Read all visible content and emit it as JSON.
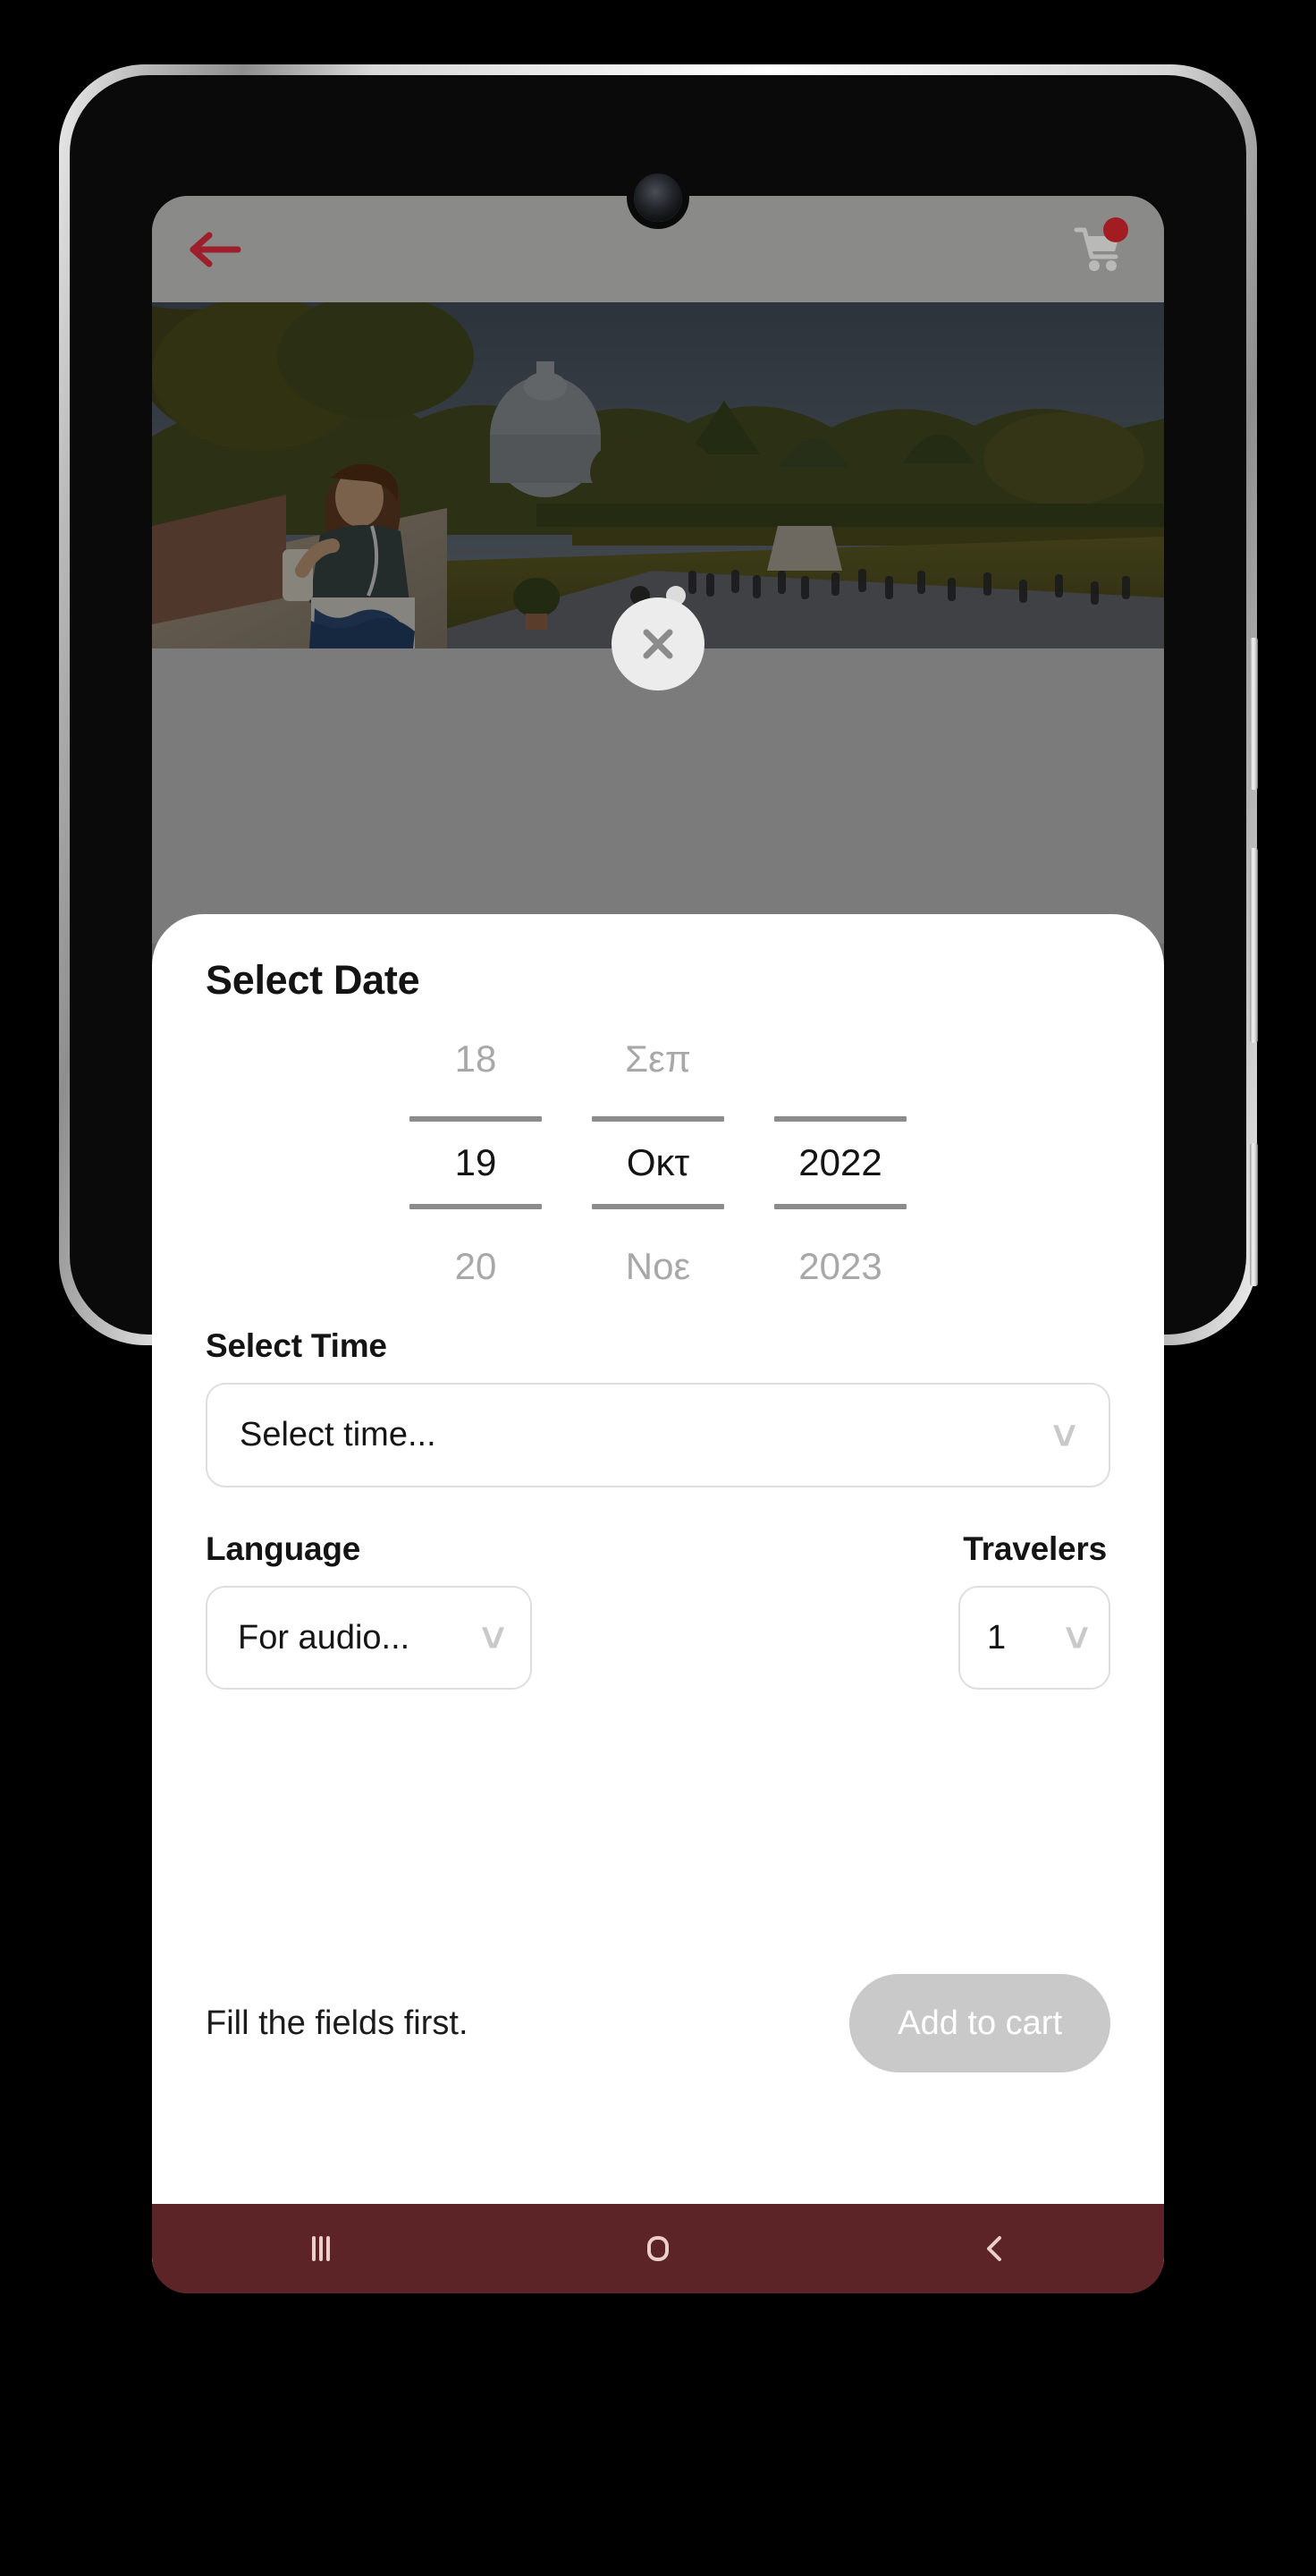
{
  "app": {
    "topbar": {
      "back_icon": "back-arrow-icon",
      "cart_icon": "shopping-cart-icon",
      "cart_badge_color": "#a21c22",
      "bar_color": "#8a8a88"
    },
    "gallery": {
      "alt": "Woman with smartphone walking in the Vatican Gardens with St. Peter's Basilica dome in the background",
      "dots_total": 2,
      "dots_active_index": 0
    },
    "close_button": {
      "icon": "close-x-icon",
      "label": "Close"
    }
  },
  "sheet": {
    "select_date": {
      "title": "Select Date",
      "day": {
        "above": "18",
        "current": "19",
        "below": "20"
      },
      "month": {
        "above": "Σεπ",
        "current": "Οκτ",
        "below": "Νοε"
      },
      "year": {
        "above": "",
        "current": "2022",
        "below": "2023"
      }
    },
    "select_time": {
      "label": "Select Time",
      "value": "Select time...",
      "placeholder": "Select time...",
      "chevron_icon": "chevron-down-icon"
    },
    "language": {
      "label": "Language",
      "value": "For audio...",
      "chevron_icon": "chevron-down-icon"
    },
    "travelers": {
      "label": "Travelers",
      "value": "1",
      "chevron_icon": "chevron-down-icon"
    },
    "footer": {
      "hint": "Fill the fields first.",
      "add_to_cart": "Add to cart",
      "add_to_cart_disabled_color": "#c9c9c9"
    }
  },
  "navbar": {
    "color": "#5d2428",
    "icon_color": "#eccfc9",
    "items": [
      {
        "name": "recents-icon",
        "label": "Recents"
      },
      {
        "name": "home-icon",
        "label": "Home"
      },
      {
        "name": "back-icon",
        "label": "Back"
      }
    ]
  }
}
